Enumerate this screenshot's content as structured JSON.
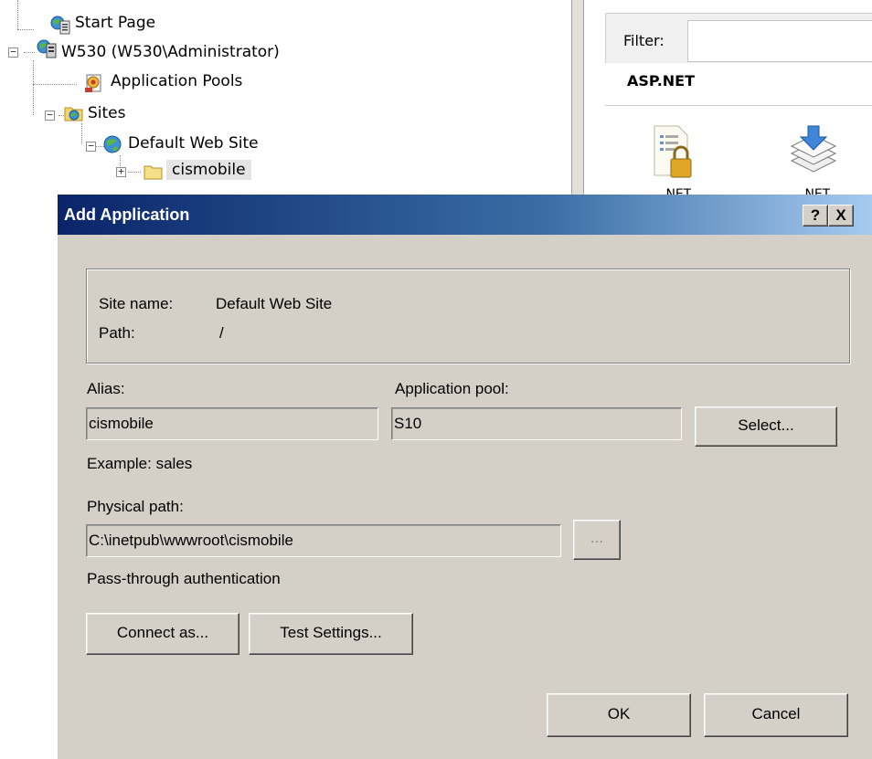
{
  "tree": {
    "items": [
      {
        "label": "Start Page",
        "icon": "start-page-icon"
      },
      {
        "label": "W530 (W530\\Administrator)",
        "icon": "server-icon"
      },
      {
        "label": "Application Pools",
        "icon": "app-pools-icon"
      },
      {
        "label": "Sites",
        "icon": "sites-folder-icon"
      },
      {
        "label": "Default Web Site",
        "icon": "globe-icon"
      },
      {
        "label": "cismobile",
        "icon": "folder-icon"
      }
    ]
  },
  "features_pane": {
    "filter_label": "Filter:",
    "filter_value": "",
    "group_title": "ASP.NET",
    "features": [
      {
        "label": ".NET",
        "icon": "lock-document-icon"
      },
      {
        "label": ".NET",
        "icon": "layers-download-icon"
      }
    ]
  },
  "dialog": {
    "title": "Add Application",
    "help_button": "?",
    "close_button": "X",
    "site_name_label": "Site name:",
    "site_name_value": "Default Web Site",
    "path_label": "Path:",
    "path_value": "/",
    "alias_label": "Alias:",
    "alias_value": "cismobile",
    "alias_example": "Example: sales",
    "app_pool_label": "Application pool:",
    "app_pool_value": "S10",
    "select_button": "Select...",
    "physical_path_label": "Physical path:",
    "physical_path_value": "C:\\inetpub\\wwwroot\\cismobile",
    "browse_button": "...",
    "pass_through_label": "Pass-through authentication",
    "connect_as_button": "Connect as...",
    "test_settings_button": "Test Settings...",
    "ok_button": "OK",
    "cancel_button": "Cancel"
  }
}
